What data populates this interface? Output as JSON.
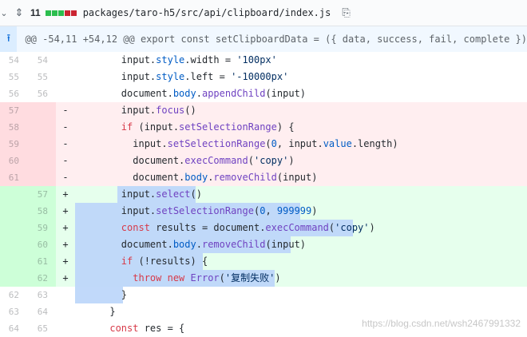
{
  "header": {
    "count": "11",
    "diffstat_colors": [
      "#2cbe4e",
      "#2cbe4e",
      "#2cbe4e",
      "#cb2431",
      "#cb2431"
    ],
    "path": "packages/taro-h5/src/api/clipboard/index.js",
    "icons": {
      "chevron": "chevron-down-icon",
      "expand": "unfold-icon",
      "copy": "clippy-icon"
    }
  },
  "hunk": {
    "text": "@@ -54,11 +54,12 @@ export const setClipboardData = ({ data, success, fail, complete })",
    "icon": "expand-up-icon"
  },
  "lines": [
    {
      "type": "ctx",
      "old": "54",
      "new": "54",
      "sign": "",
      "code": "        input.style.width = '100px'"
    },
    {
      "type": "ctx",
      "old": "55",
      "new": "55",
      "sign": "",
      "code": "        input.style.left = '-10000px'"
    },
    {
      "type": "ctx",
      "old": "56",
      "new": "56",
      "sign": "",
      "code": "        document.body.appendChild(input)"
    },
    {
      "type": "del",
      "old": "57",
      "new": "",
      "sign": "-",
      "code": "        input.focus()"
    },
    {
      "type": "del",
      "old": "58",
      "new": "",
      "sign": "-",
      "code": "        if (input.setSelectionRange) {"
    },
    {
      "type": "del",
      "old": "59",
      "new": "",
      "sign": "-",
      "code": "          input.setSelectionRange(0, input.value.length)"
    },
    {
      "type": "del",
      "old": "60",
      "new": "",
      "sign": "-",
      "code": "          document.execCommand('copy')"
    },
    {
      "type": "del",
      "old": "61",
      "new": "",
      "sign": "-",
      "code": "          document.body.removeChild(input)"
    },
    {
      "type": "add",
      "old": "",
      "new": "57",
      "sign": "+",
      "code": "        input.select()"
    },
    {
      "type": "add",
      "old": "",
      "new": "58",
      "sign": "+",
      "code": "        input.setSelectionRange(0, 999999)"
    },
    {
      "type": "add",
      "old": "",
      "new": "59",
      "sign": "+",
      "code": "        const results = document.execCommand('copy')"
    },
    {
      "type": "add",
      "old": "",
      "new": "60",
      "sign": "+",
      "code": "        document.body.removeChild(input)"
    },
    {
      "type": "add",
      "old": "",
      "new": "61",
      "sign": "+",
      "code": "        if (!results) {"
    },
    {
      "type": "add",
      "old": "",
      "new": "62",
      "sign": "+",
      "code": "          throw new Error('复制失败')"
    },
    {
      "type": "ctx",
      "old": "62",
      "new": "63",
      "sign": "",
      "code": "        }"
    },
    {
      "type": "ctx",
      "old": "63",
      "new": "64",
      "sign": "",
      "code": "      }"
    },
    {
      "type": "ctx",
      "old": "64",
      "new": "65",
      "sign": "",
      "code": "      const res = {"
    }
  ],
  "watermark": "https://blog.csdn.net/wsh2467991332"
}
